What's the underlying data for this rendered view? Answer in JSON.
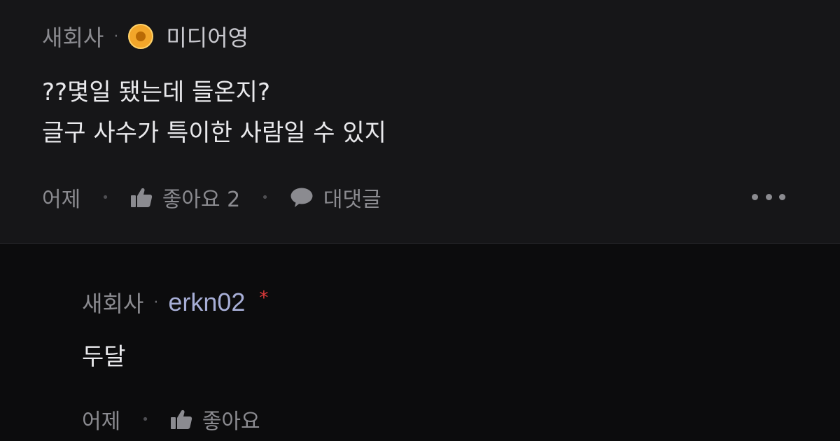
{
  "comments": [
    {
      "company": "새회사",
      "separator": "·",
      "badge_icon": "gold-medal-icon",
      "author": "미디어영",
      "lines": [
        "??몇일 됐는데 들온지?",
        "글구 사수가 특이한 사람일 수 있지"
      ],
      "time": "어제",
      "like_label": "좋아요 2",
      "reply_label": "대댓글",
      "more_icon": "more-horizontal-icon"
    },
    {
      "company": "새회사",
      "separator": "·",
      "author": "erkn02",
      "author_mark": "*",
      "lines": [
        "두달"
      ],
      "time": "어제",
      "like_label": "좋아요"
    }
  ],
  "colors": {
    "background": "#0c0c0d",
    "comment_bg": "#161618",
    "text": "#e9e9ec",
    "muted": "#8b8b90",
    "badge": "#f2a62a",
    "reply_author": "#a7aed6",
    "author_mark": "#e23b3b"
  }
}
